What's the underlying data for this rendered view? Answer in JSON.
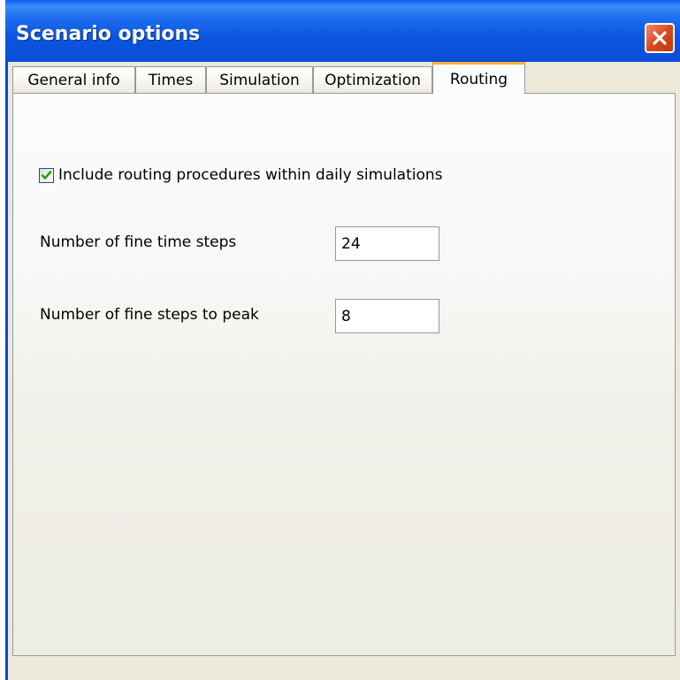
{
  "window": {
    "title": "Scenario options"
  },
  "title_bar": {
    "close_icon": "close-icon",
    "close_button_color": "#d84a1c",
    "title_color": "#0a55e0"
  },
  "tabs": [
    {
      "label": "General info",
      "active": false
    },
    {
      "label": "Times",
      "active": false
    },
    {
      "label": "Simulation",
      "active": false
    },
    {
      "label": "Optimization",
      "active": false
    },
    {
      "label": "Routing",
      "active": true
    }
  ],
  "routing": {
    "include_routing": {
      "label": "Include routing procedures within daily simulations",
      "checked": true
    },
    "fine_time_steps": {
      "label": "Number of fine time steps",
      "value": "24"
    },
    "fine_steps_to_peak": {
      "label": "Number of fine steps to peak",
      "value": "8"
    }
  },
  "colors": {
    "checkmark": "#21a121",
    "active_tab_highlight": "#f6b53b",
    "input_border": "#7f9db9"
  }
}
